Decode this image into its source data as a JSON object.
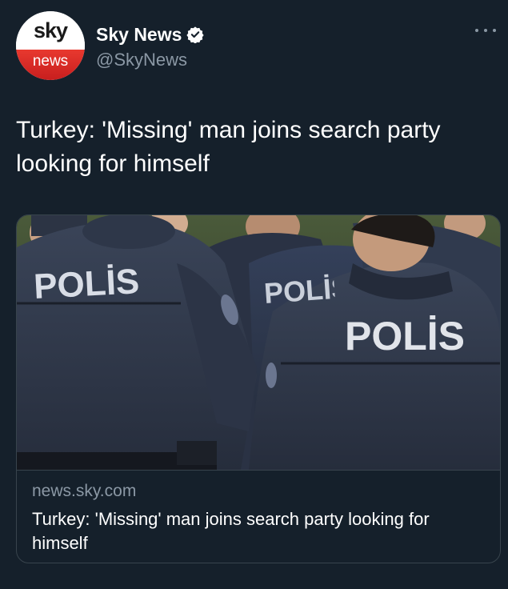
{
  "tweet": {
    "author": {
      "display_name": "Sky News",
      "handle": "@SkyNews",
      "verified": true,
      "avatar": {
        "top_text": "sky",
        "bottom_text": "news"
      }
    },
    "more_icon": "ellipsis-icon",
    "text": "Turkey: 'Missing' man joins search party looking for himself"
  },
  "card": {
    "image": {
      "description_icon": "police-officers-photo",
      "labels": [
        "POLİS",
        "POLİS",
        "POLİS"
      ]
    },
    "domain": "news.sky.com",
    "title": "Turkey: 'Missing' man joins search party looking for himself"
  },
  "colors": {
    "background": "#15202b",
    "secondary_text": "#8b98a5",
    "border": "#38444d",
    "verified": "#ffffff",
    "sky_red": "#d42a24"
  }
}
